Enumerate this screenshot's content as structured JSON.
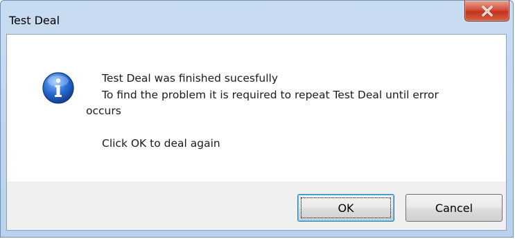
{
  "window": {
    "title": "Test Deal"
  },
  "message": {
    "line1": "Test Deal was finished sucesfully",
    "line2": "To find the problem it is required to repeat Test Deal until error",
    "line3": "occurs",
    "line4": "Click OK to deal again"
  },
  "icons": {
    "info": "information-icon",
    "close": "close-icon"
  },
  "buttons": {
    "ok_label": "OK",
    "cancel_label": "Cancel"
  },
  "colors": {
    "titlebar": "#c9dcf1",
    "close_button": "#c2331f",
    "info_icon": "#1f5fbf",
    "button_face": "#e5e5e5",
    "focus_border": "#3c7fb1"
  }
}
